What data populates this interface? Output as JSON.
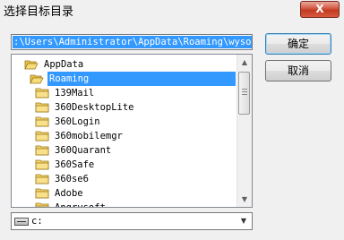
{
  "window": {
    "title": "选择目标目录",
    "close_glyph": "X"
  },
  "path": {
    "value": ":\\Users\\Administrator\\AppData\\Roaming\\wysoft"
  },
  "buttons": {
    "ok_label": "确定",
    "cancel_label": "取消"
  },
  "tree": {
    "items": [
      {
        "label": "AppData",
        "state": "open"
      },
      {
        "label": "Roaming",
        "state": "open-selected"
      },
      {
        "label": "139Mail",
        "state": "closed"
      },
      {
        "label": "360DesktopLite",
        "state": "closed"
      },
      {
        "label": "360Login",
        "state": "closed"
      },
      {
        "label": "360mobilemgr",
        "state": "closed"
      },
      {
        "label": "360Quarant",
        "state": "closed"
      },
      {
        "label": "360Safe",
        "state": "closed"
      },
      {
        "label": "360se6",
        "state": "closed"
      },
      {
        "label": "Adobe",
        "state": "closed"
      },
      {
        "label": "Angrysoft",
        "state": "closed"
      }
    ]
  },
  "scroll": {
    "up_glyph": "▲",
    "down_glyph": "▼"
  },
  "drive": {
    "value": "c:",
    "arrow_glyph": "▼",
    "icon": "drive-icon"
  },
  "colors": {
    "selection": "#3399ff",
    "folder": "#f5d46b"
  }
}
